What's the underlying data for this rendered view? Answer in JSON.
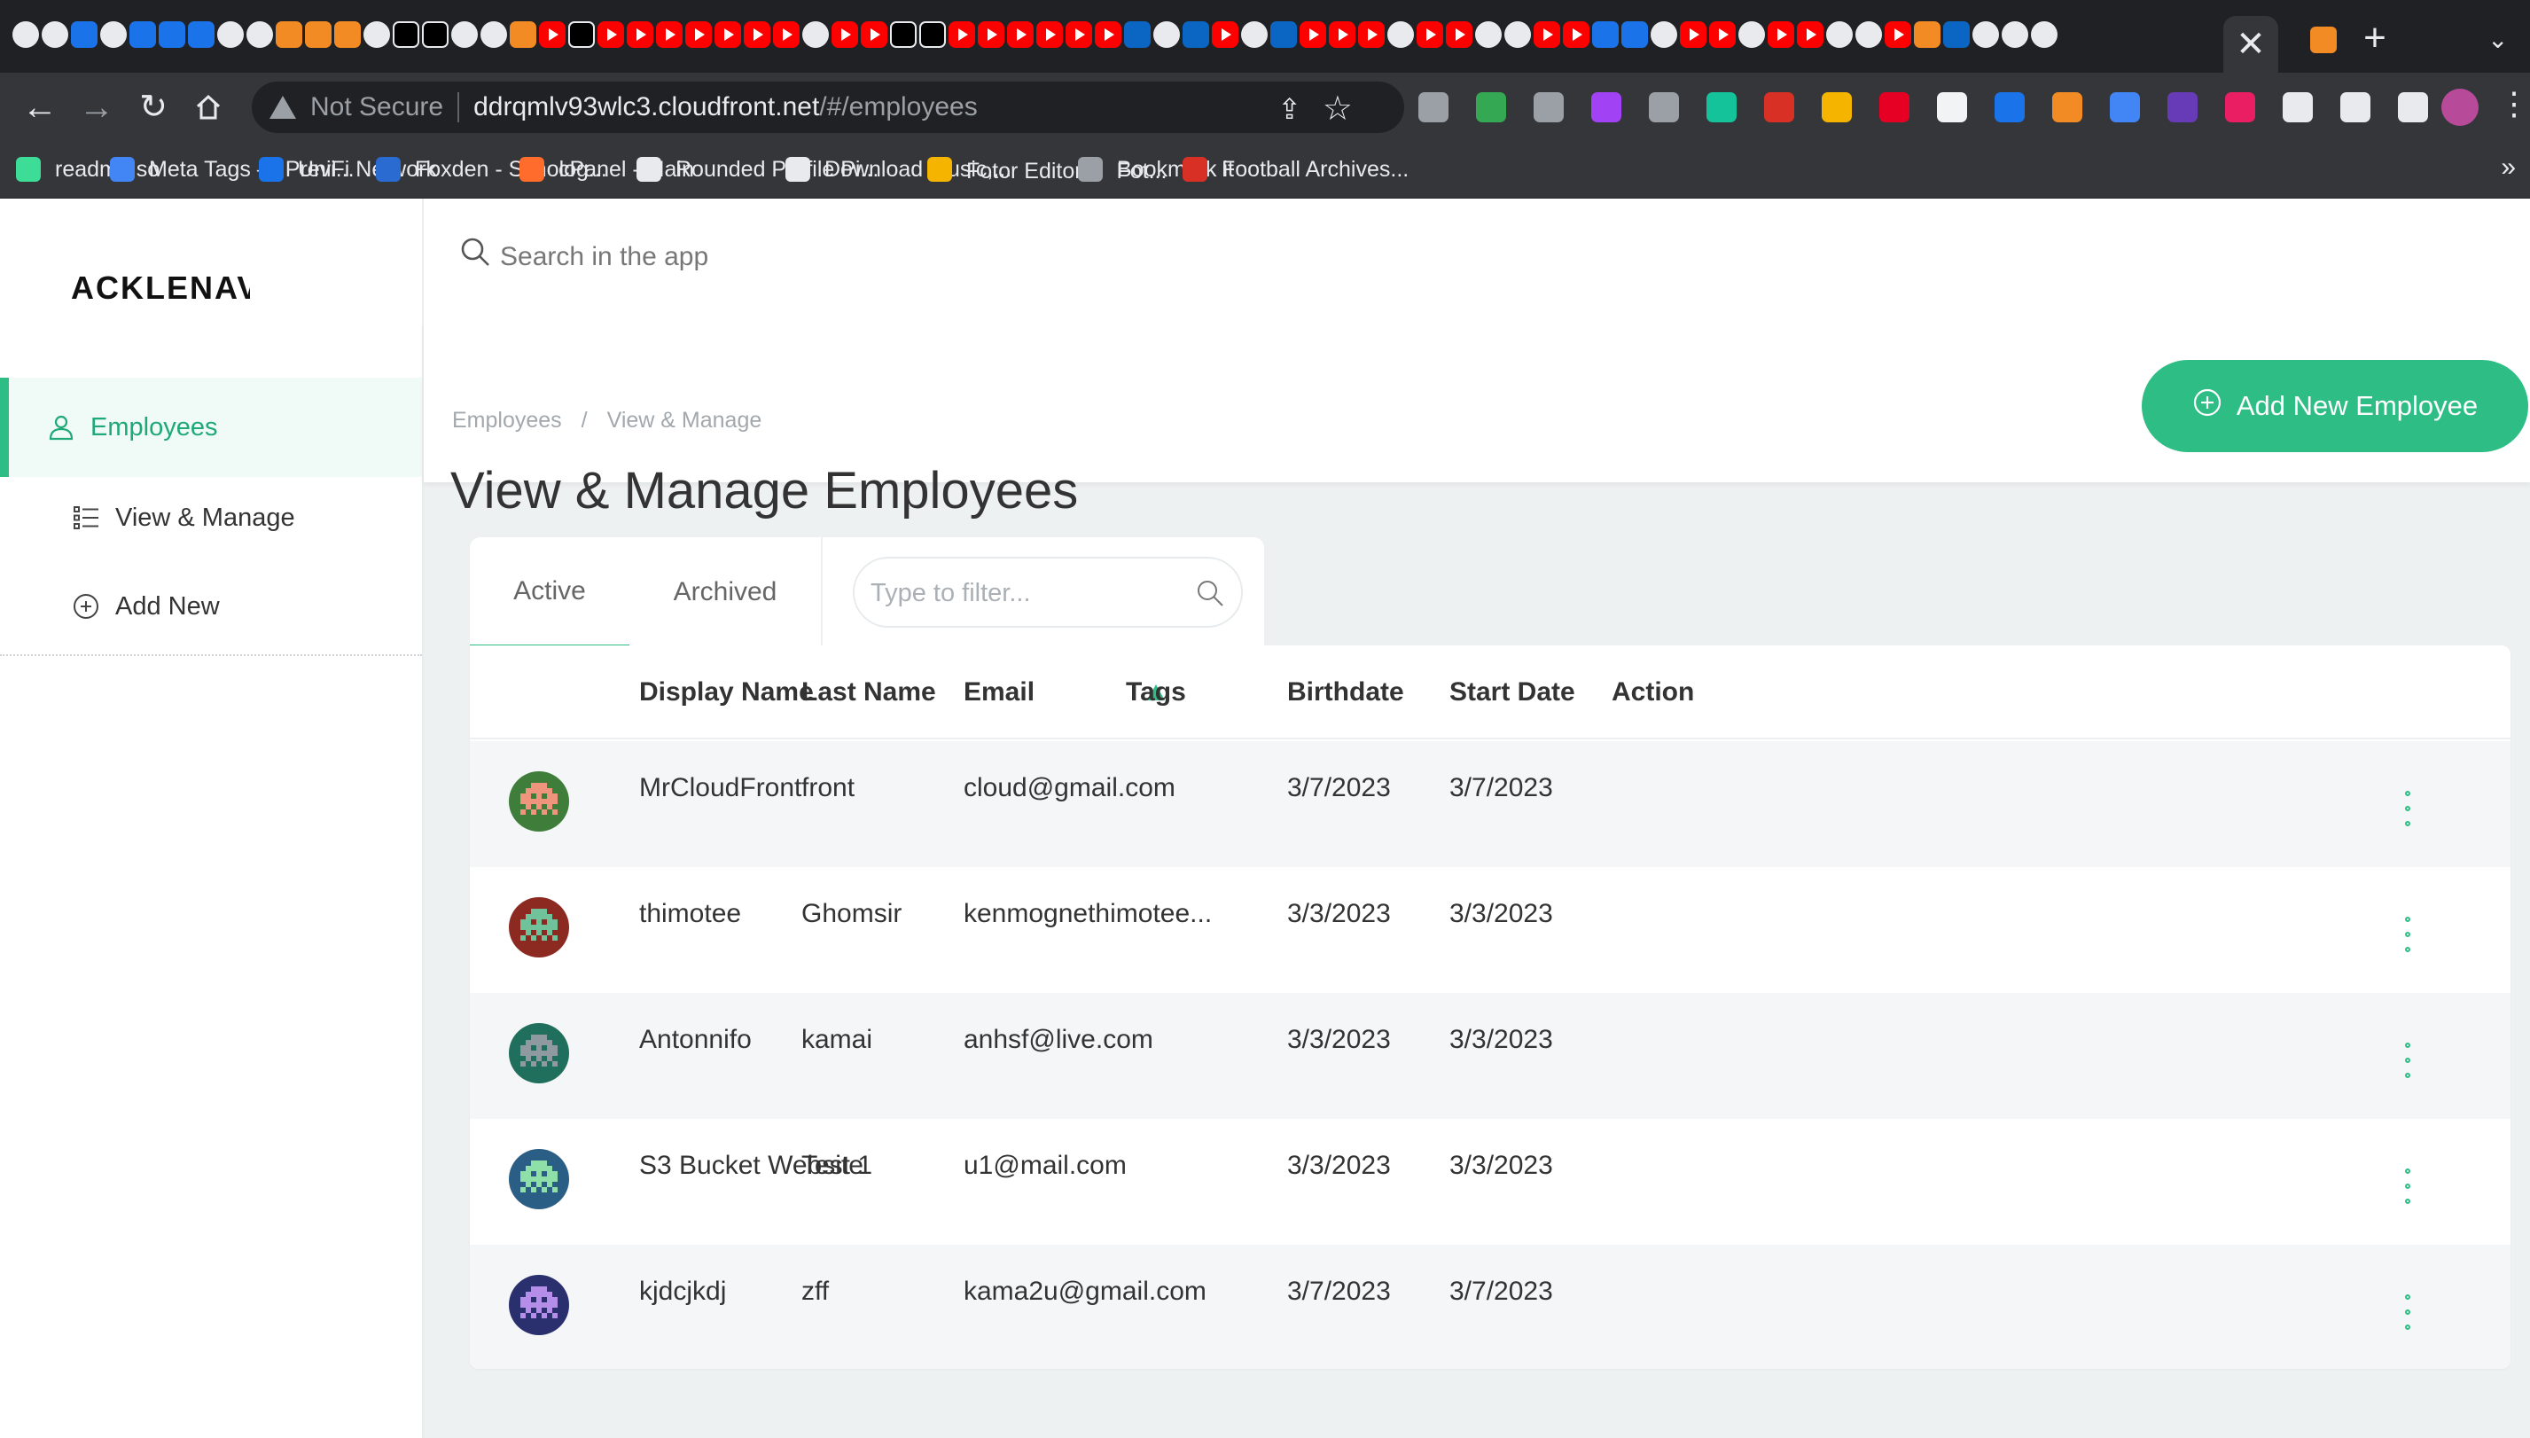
{
  "browser": {
    "tab_close": "✕",
    "new_tab": "+",
    "not_secure": "Not Secure",
    "url_host": "ddrqmlv93wlc3.cloudfront.net",
    "url_path": "/#/employees",
    "bookmarks": [
      {
        "label": "readme.so",
        "color": "#3ddc97"
      },
      {
        "label": "Meta Tags — Previ...",
        "color": "#4285f4"
      },
      {
        "label": "UniFi Network",
        "color": "#1a73e8"
      },
      {
        "label": "Foxden - Synolog...",
        "color": "#2a6bd2"
      },
      {
        "label": "cPanel - Main",
        "color": "#ff6c2c"
      },
      {
        "label": "Rounded Profile Pi...",
        "color": "#e8eaed"
      },
      {
        "label": "Download music,...",
        "color": "#e8eaed"
      },
      {
        "label": "Fotor Editor ｜ Fot...",
        "color": "#f4b400"
      },
      {
        "label": "Bookmark it",
        "color": "#9aa0a6"
      },
      {
        "label": "Football Archives...",
        "color": "#d93025"
      }
    ],
    "bookmarks_more": "»"
  },
  "app": {
    "logo": "ACKLENAVENUE",
    "search_placeholder": "Search in the app",
    "sidebar": {
      "items": [
        {
          "label": "Employees",
          "icon": "user-icon"
        },
        {
          "label": "View & Manage",
          "icon": "list-icon"
        },
        {
          "label": "Add New",
          "icon": "plus-circle-icon"
        }
      ]
    },
    "breadcrumb": {
      "first": "Employees",
      "separator": "/",
      "second": "View & Manage"
    },
    "page_title": "View & Manage Employees",
    "add_button_label": "Add New Employee",
    "tabs": {
      "active": "Active",
      "archived": "Archived"
    },
    "filter_placeholder": "Type to filter...",
    "accent_color": "#2ebd85",
    "table": {
      "columns": {
        "display_name": "Display Name",
        "last_name": "Last Name",
        "email": "Email",
        "tags": "Tags",
        "birthdate": "Birthdate",
        "start_date": "Start Date",
        "action": "Action"
      },
      "rows": [
        {
          "display_name": "MrCloudFront",
          "last_name": "front",
          "email": "cloud@gmail.com",
          "tags": "",
          "birthdate": "3/7/2023",
          "start_date": "3/7/2023",
          "avatar_bg": "#3f7d3a",
          "avatar_fg": "#f0957d"
        },
        {
          "display_name": "thimotee",
          "last_name": "Ghomsir",
          "email": "kenmognethimotee...",
          "tags": "",
          "birthdate": "3/3/2023",
          "start_date": "3/3/2023",
          "avatar_bg": "#8c2a22",
          "avatar_fg": "#6fc29a"
        },
        {
          "display_name": "Antonnifo",
          "last_name": "kamai",
          "email": "anhsf@live.com",
          "tags": "",
          "birthdate": "3/3/2023",
          "start_date": "3/3/2023",
          "avatar_bg": "#1f6f5c",
          "avatar_fg": "#8e9aa0"
        },
        {
          "display_name": "S3 Bucket Website",
          "last_name": "Test 1",
          "email": "u1@mail.com",
          "tags": "",
          "birthdate": "3/3/2023",
          "start_date": "3/3/2023",
          "avatar_bg": "#2b5e85",
          "avatar_fg": "#8fe0a8"
        },
        {
          "display_name": "kjdcjkdj",
          "last_name": "zff",
          "email": "kama2u@gmail.com",
          "tags": "",
          "birthdate": "3/7/2023",
          "start_date": "3/7/2023",
          "avatar_bg": "#2a2f6e",
          "avatar_fg": "#b48ee8"
        }
      ]
    }
  }
}
